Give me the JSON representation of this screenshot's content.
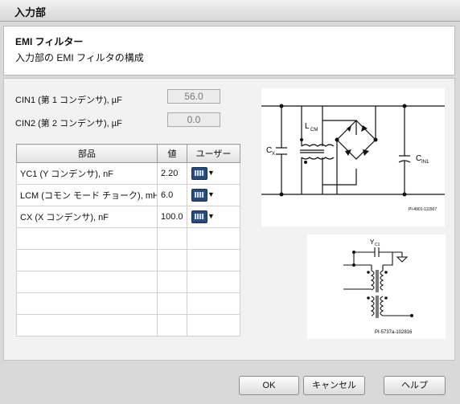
{
  "window": {
    "title": "入力部"
  },
  "header": {
    "title": "EMI フィルター",
    "subtitle": "入力部の EMI フィルタの構成"
  },
  "fields": [
    {
      "label": "CIN1 (第 1 コンデンサ), µF",
      "value": "56.0"
    },
    {
      "label": "CIN2 (第 2 コンデンサ), µF",
      "value": "0.0"
    }
  ],
  "table": {
    "headers": [
      "部品",
      "値",
      "ユーザー"
    ],
    "rows": [
      {
        "part": "YC1 (Y コンデンサ), nF",
        "value": "2.20"
      },
      {
        "part": "LCM (コモン モード チョーク), mH",
        "value": "6.0"
      },
      {
        "part": "CX (X コンデンサ), nF",
        "value": "100.0"
      }
    ]
  },
  "diagram1": {
    "label_cx": "C",
    "label_cx_sub": "X",
    "label_lcm": "L",
    "label_lcm_sub": "CM",
    "label_cin": "C",
    "label_cin_sub": "IN1",
    "figure_id": "PI-4901-111507"
  },
  "diagram2": {
    "label_yc": "Y",
    "label_yc_sub": "C1",
    "figure_id": "PI-5737a-102816"
  },
  "buttons": {
    "ok": "OK",
    "cancel": "キャンセル",
    "help": "ヘルプ"
  },
  "icons": {
    "user_pick": "calculator-dropdown-icon"
  }
}
